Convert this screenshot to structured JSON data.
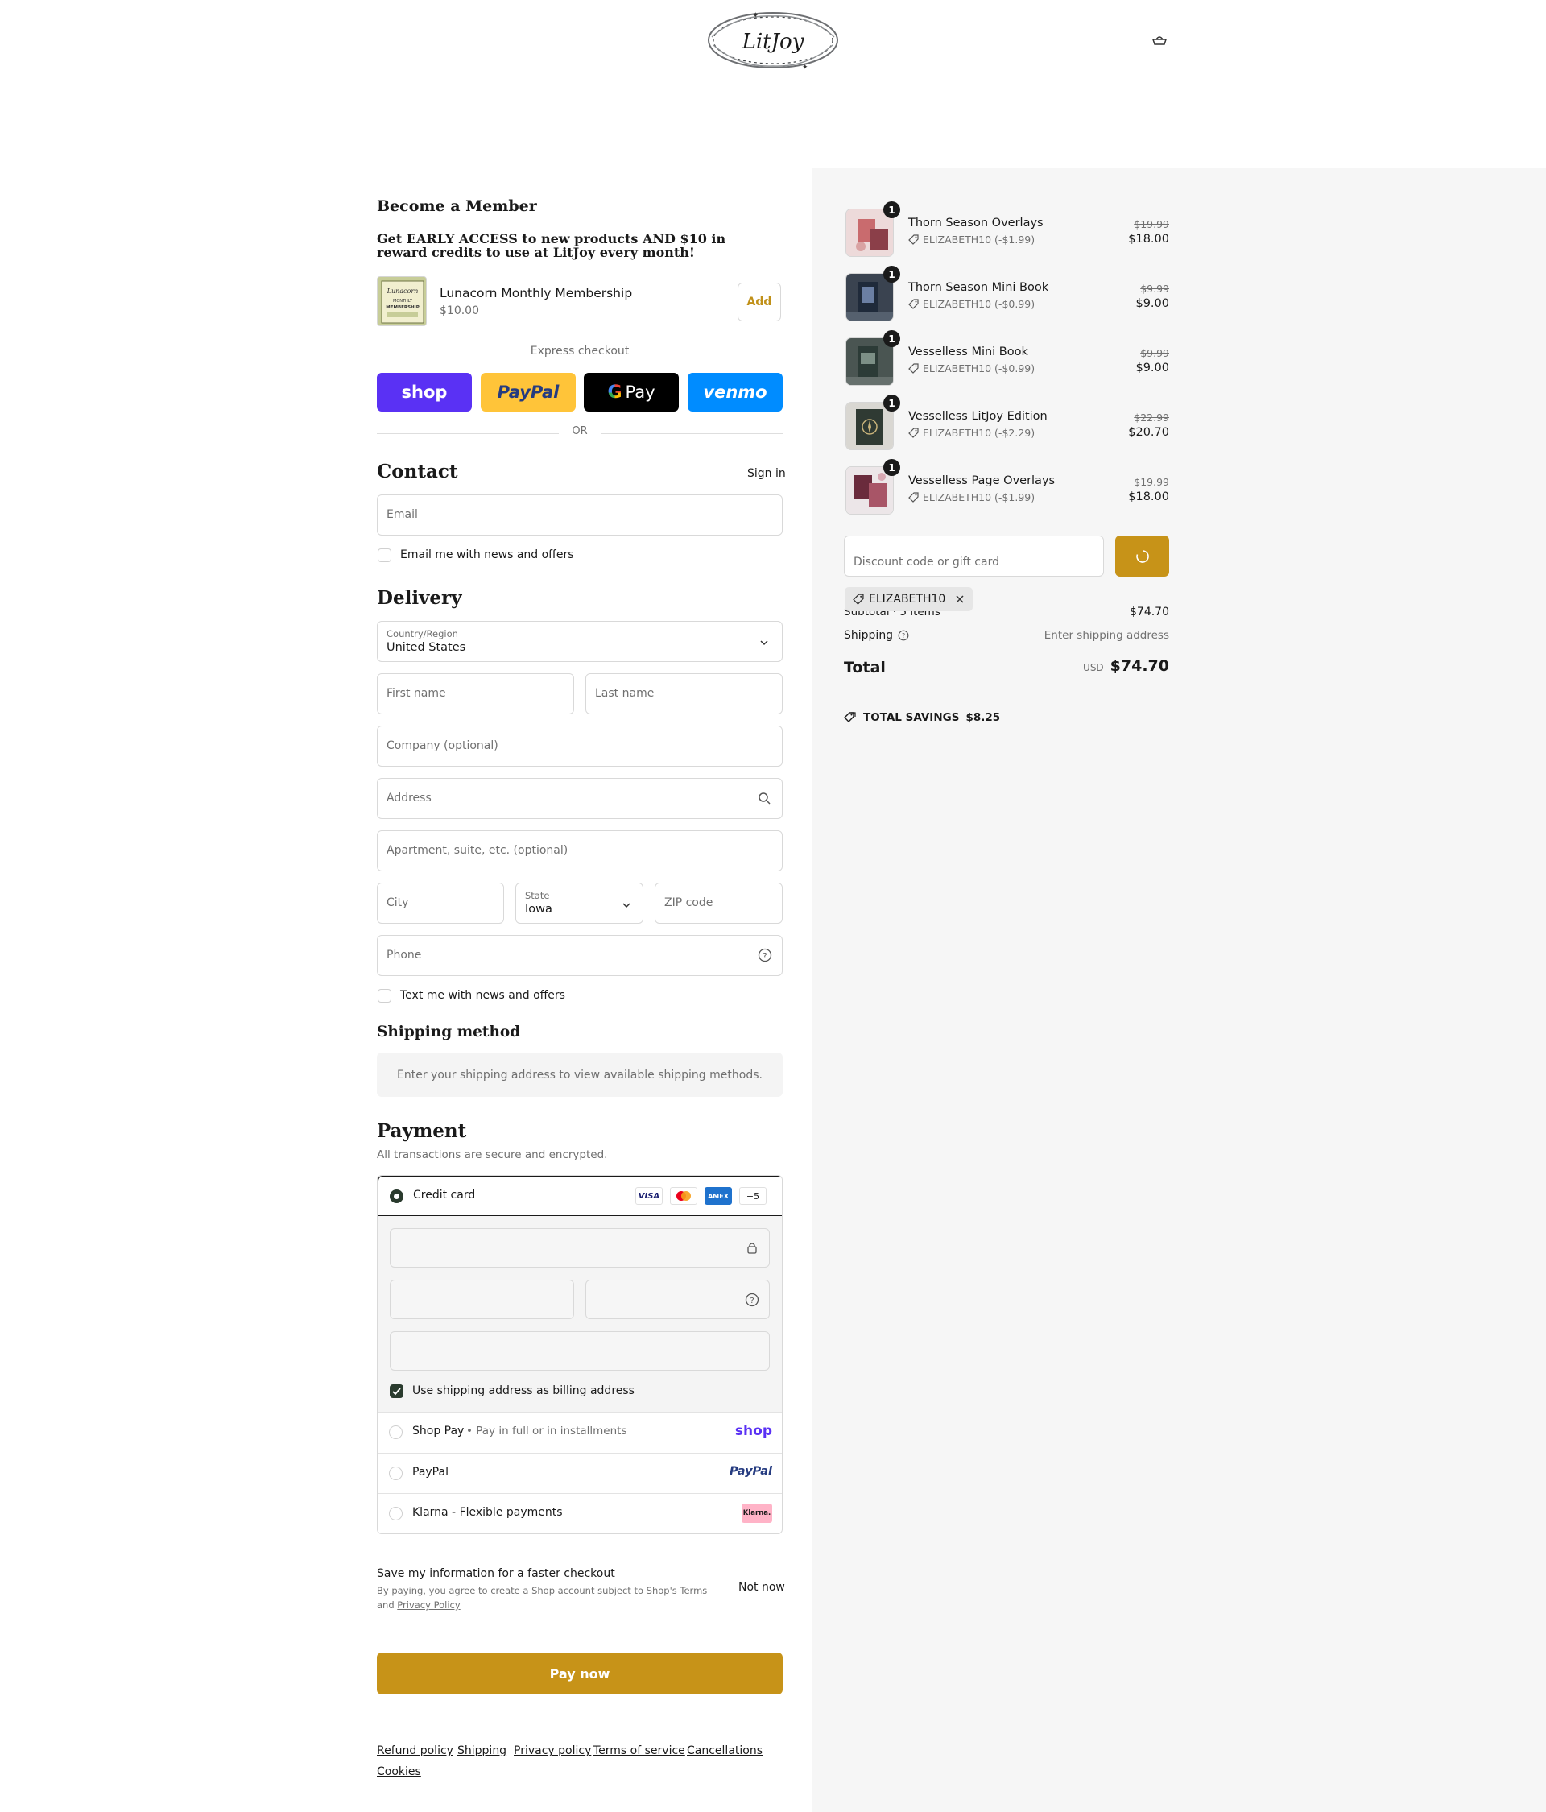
{
  "header": {
    "logo_text": "LitJoy",
    "cart_icon": "cart-icon"
  },
  "membership": {
    "title": "Become a Member",
    "description": "Get EARLY ACCESS to new products AND $10 in reward credits to use at LitJoy every month!",
    "product_name": "Lunacorn Monthly Membership",
    "product_price": "$10.00",
    "add_label": "Add"
  },
  "express": {
    "label": "Express checkout",
    "or_label": "OR",
    "shop_label": "shop",
    "paypal_label": "PayPal",
    "gpay_label": "Pay",
    "venmo_label": "venmo"
  },
  "contact": {
    "title": "Contact",
    "signin_label": "Sign in",
    "email_placeholder": "Email",
    "news_label": "Email me with news and offers"
  },
  "delivery": {
    "title": "Delivery",
    "country_label": "Country/Region",
    "country_value": "United States",
    "first_name_placeholder": "First name",
    "last_name_placeholder": "Last name",
    "company_placeholder": "Company (optional)",
    "address_placeholder": "Address",
    "apartment_placeholder": "Apartment, suite, etc. (optional)",
    "city_placeholder": "City",
    "state_label": "State",
    "state_value": "Iowa",
    "zip_placeholder": "ZIP code",
    "phone_placeholder": "Phone",
    "text_news_label": "Text me with news and offers"
  },
  "shipping_method": {
    "title": "Shipping method",
    "info": "Enter your shipping address to view available shipping methods."
  },
  "payment": {
    "title": "Payment",
    "subtitle": "All transactions are secure and encrypted.",
    "credit_card_label": "Credit card",
    "card_visa": "VISA",
    "card_amex": "AMEX",
    "card_more": "+5",
    "billing_label": "Use shipping address as billing address",
    "shop_pay_label": "Shop Pay",
    "shop_pay_sub": "Pay in full or in installments",
    "shop_pay_logo": "shop",
    "paypal_label": "PayPal",
    "paypal_logo": "PayPal",
    "klarna_label": "Klarna - Flexible payments",
    "klarna_logo": "Klarna."
  },
  "save_info": {
    "title": "Save my information for a faster checkout",
    "legal_prefix": "By paying, you agree to create a Shop account subject to Shop's",
    "terms": "Terms",
    "and": "and",
    "privacy": "Privacy Policy",
    "not_now": "Not now"
  },
  "pay_now_label": "Pay now",
  "footer_links": [
    "Refund policy",
    "Shipping",
    "Privacy policy",
    "Terms of service",
    "Cancellations",
    "Cookies"
  ],
  "order": {
    "items": [
      {
        "name": "Thorn Season Overlays",
        "discount": "ELIZABETH10 (-$1.99)",
        "old_price": "$19.99",
        "price": "$18.00",
        "qty": "1"
      },
      {
        "name": "Thorn Season Mini Book",
        "discount": "ELIZABETH10 (-$0.99)",
        "old_price": "$9.99",
        "price": "$9.00",
        "qty": "1"
      },
      {
        "name": "Vesselless Mini Book",
        "discount": "ELIZABETH10 (-$0.99)",
        "old_price": "$9.99",
        "price": "$9.00",
        "qty": "1"
      },
      {
        "name": "Vesselless LitJoy Edition",
        "discount": "ELIZABETH10 (-$2.29)",
        "old_price": "$22.99",
        "price": "$20.70",
        "qty": "1"
      },
      {
        "name": "Vesselless Page Overlays",
        "discount": "ELIZABETH10 (-$1.99)",
        "old_price": "$19.99",
        "price": "$18.00",
        "qty": "1"
      }
    ],
    "discount_placeholder": "Discount code or gift card",
    "applied_code": "ELIZABETH10",
    "subtotal_label": "Subtotal · 5 items",
    "subtotal_value": "$74.70",
    "shipping_label": "Shipping",
    "shipping_value": "Enter shipping address",
    "total_label": "Total",
    "currency": "USD",
    "total_value": "$74.70",
    "savings_label": "TOTAL SAVINGS",
    "savings_value": "$8.25"
  },
  "colors": {
    "accent": "#c79318",
    "shop_purple": "#5a31f4",
    "paypal_yellow": "#ffc439",
    "venmo_blue": "#008cff"
  }
}
